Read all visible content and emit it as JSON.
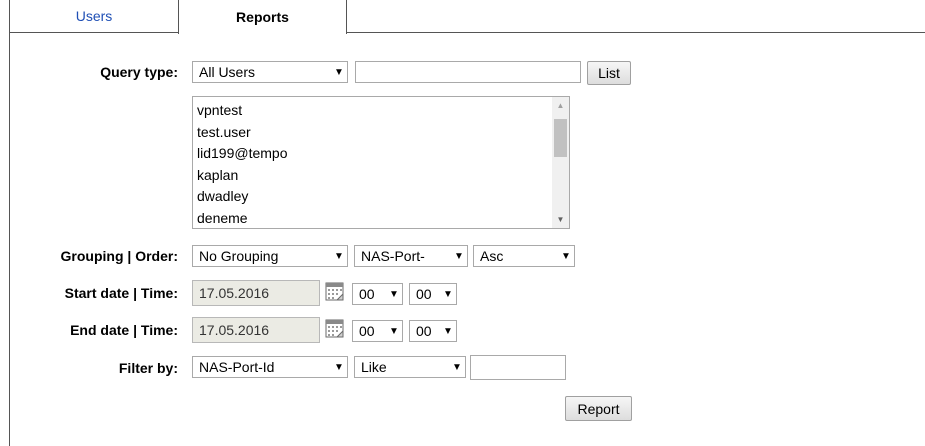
{
  "tabs": {
    "users": "Users",
    "reports": "Reports"
  },
  "query": {
    "label": "Query type:",
    "type_value": "All Users",
    "text_value": "",
    "list_button": "List",
    "users": [
      "vpntest",
      "test.user",
      "lid199@tempo",
      "kaplan",
      "dwadley",
      "deneme"
    ]
  },
  "grouping": {
    "label": "Grouping | Order:",
    "group_value": "No Grouping",
    "field_value": "NAS-Port-",
    "order_value": "Asc"
  },
  "start": {
    "label": "Start date | Time:",
    "date": "17.05.2016",
    "hour": "00",
    "minute": "00"
  },
  "end": {
    "label": "End date | Time:",
    "date": "17.05.2016",
    "hour": "00",
    "minute": "00"
  },
  "filter": {
    "label": "Filter by:",
    "field_value": "NAS-Port-Id",
    "op_value": "Like",
    "text_value": ""
  },
  "report_button": "Report",
  "icons": {
    "calendar": "calendar-icon",
    "dropdown": "dropdown-arrow-icon"
  },
  "colors": {
    "tab_link": "#1f4fb5",
    "readonly_bg": "#ebebe4"
  }
}
